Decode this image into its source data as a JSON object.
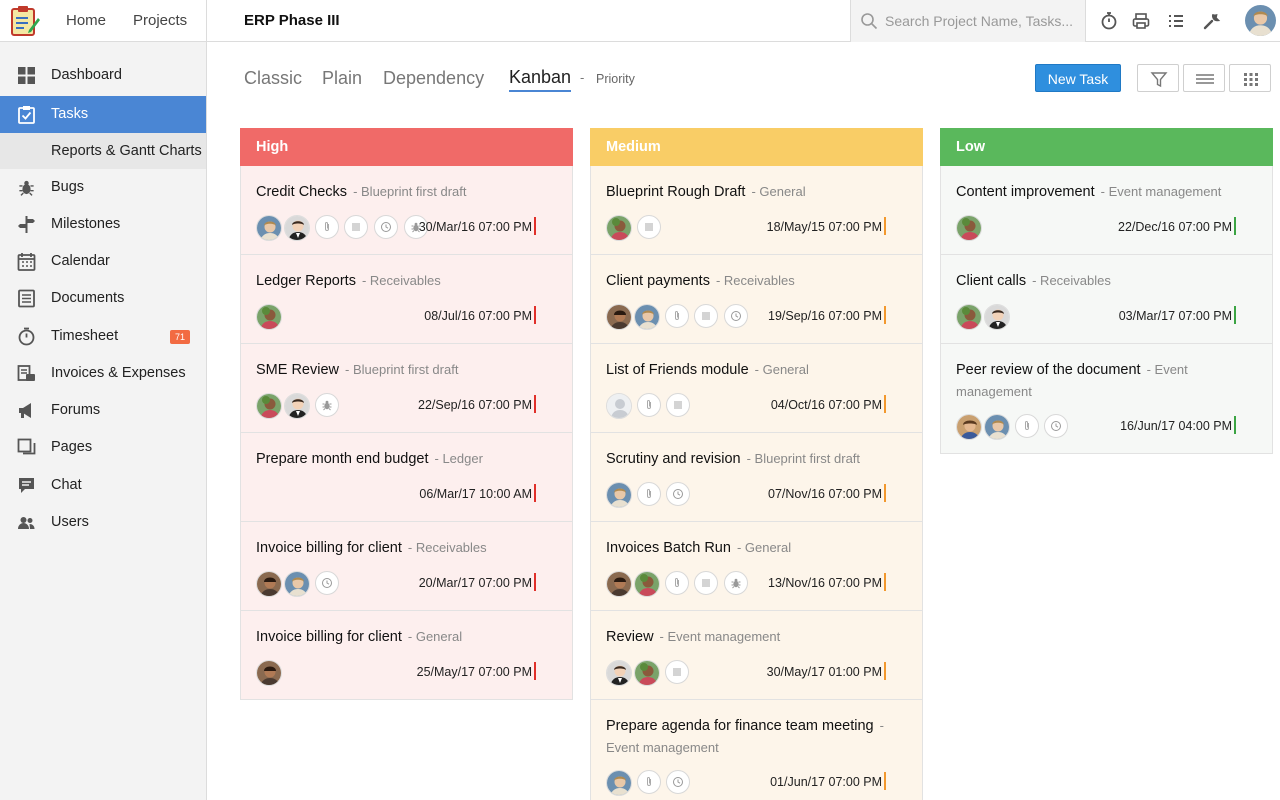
{
  "topbar": {
    "home": "Home",
    "projects": "Projects",
    "project_title": "ERP Phase III",
    "search_placeholder": "Search Project Name, Tasks..."
  },
  "sidebar": {
    "items": [
      {
        "label": "Dashboard",
        "icon": "dashboard-icon"
      },
      {
        "label": "Tasks",
        "icon": "tasks-icon"
      },
      {
        "label": "Reports & Gantt Charts",
        "icon": ""
      },
      {
        "label": "Bugs",
        "icon": "bug-icon"
      },
      {
        "label": "Milestones",
        "icon": "milestone-icon"
      },
      {
        "label": "Calendar",
        "icon": "calendar-icon"
      },
      {
        "label": "Documents",
        "icon": "documents-icon"
      },
      {
        "label": "Timesheet",
        "icon": "timesheet-icon",
        "badge": "71"
      },
      {
        "label": "Invoices & Expenses",
        "icon": "invoice-icon"
      },
      {
        "label": "Forums",
        "icon": "forum-icon"
      },
      {
        "label": "Pages",
        "icon": "pages-icon"
      },
      {
        "label": "Chat",
        "icon": "chat-icon"
      },
      {
        "label": "Users",
        "icon": "users-icon"
      }
    ],
    "active_color": "#4a86d4"
  },
  "views": {
    "tabs": [
      "Classic",
      "Plain",
      "Dependency",
      "Kanban"
    ],
    "active": "Kanban",
    "separator": "-",
    "grouping": "Priority",
    "new_task": "New Task"
  },
  "columns": [
    {
      "name": "High",
      "color": "#f06a68",
      "cards": [
        {
          "title": "Credit Checks",
          "category": "- Blueprint first draft",
          "due": "30/Mar/16 07:00 PM"
        },
        {
          "title": "Ledger Reports",
          "category": "- Receivables",
          "due": "08/Jul/16 07:00 PM"
        },
        {
          "title": "SME Review",
          "category": "- Blueprint first draft",
          "due": "22/Sep/16 07:00 PM"
        },
        {
          "title": "Prepare month end budget",
          "category": "- Ledger",
          "due": "06/Mar/17 10:00 AM"
        },
        {
          "title": "Invoice billing for client",
          "category": "- Receivables",
          "due": "20/Mar/17 07:00 PM"
        },
        {
          "title": "Invoice billing for client",
          "category": "- General",
          "due": "25/May/17 07:00 PM"
        }
      ]
    },
    {
      "name": "Medium",
      "color": "#f9cd66",
      "cards": [
        {
          "title": "Blueprint Rough Draft",
          "category": "- General",
          "due": "18/May/15 07:00 PM"
        },
        {
          "title": "Client payments",
          "category": "- Receivables",
          "due": "19/Sep/16 07:00 PM"
        },
        {
          "title": "List of Friends module",
          "category": "- General",
          "due": "04/Oct/16 07:00 PM"
        },
        {
          "title": "Scrutiny and revision",
          "category": "- Blueprint first draft",
          "due": "07/Nov/16 07:00 PM"
        },
        {
          "title": "Invoices Batch Run",
          "category": "- General",
          "due": "13/Nov/16 07:00 PM"
        },
        {
          "title": "Review",
          "category": "- Event management",
          "due": "30/May/17 01:00 PM"
        },
        {
          "title": "Prepare agenda for finance team meeting",
          "category": "- Event management",
          "due": "01/Jun/17 07:00 PM"
        }
      ]
    },
    {
      "name": "Low",
      "color": "#5ab85c",
      "cards": [
        {
          "title": "Content improvement",
          "category": "- Event management",
          "due": "22/Dec/16 07:00 PM"
        },
        {
          "title": "Client calls",
          "category": "- Receivables",
          "due": "03/Mar/17 07:00 PM"
        },
        {
          "title": "Peer review of the document",
          "category": "- Event management",
          "due": "16/Jun/17 04:00 PM"
        }
      ]
    }
  ]
}
